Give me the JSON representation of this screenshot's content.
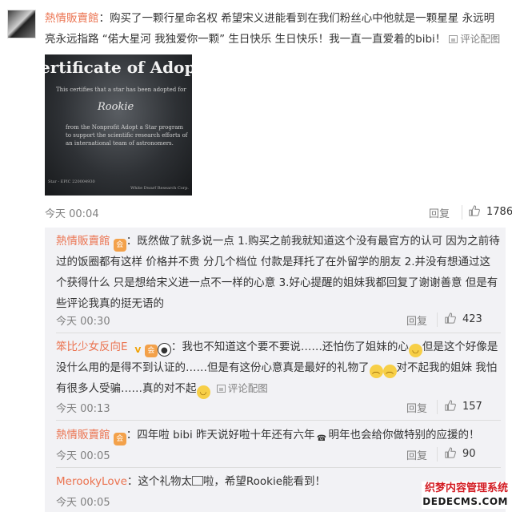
{
  "main_comment": {
    "username": "熱情販賣館",
    "text": "：购买了一颗行星命名权 希望宋义进能看到在我们粉丝心中他就是一颗星星 永远明亮永远指路 “偌大星河 我独爱你一颗” 生日快乐 生日快乐！我一直一直爱着的bibi！",
    "view_pics": "评论配图",
    "time": "今天 00:04",
    "reply": "回复",
    "likes": "1786",
    "certificate": {
      "title": "ertificate of Adopti",
      "line1": "This certifies that a star has been adopted for",
      "name": "Rookie",
      "body": "from the Nonprofit Adopt a Star program\nto support the scientific research efforts of\nan international team of astronomers.",
      "foot": "Star - EPIC 220004930",
      "foot2": "White Dwarf Research Corp."
    }
  },
  "replies": [
    {
      "username": "熱情販賣館",
      "text": "：既然做了就多说一点 1.购买之前我就知道这个没有最官方的认可 因为之前待过的饭圈都有这样 价格并不贵 分几个档位 付款是拜托了在外留学的朋友 2.并没有想通过这个获得什么 只是想给宋义进一点不一样的心意 3.好心提醒的姐妹我都回复了谢谢善意 但是有些评论我真的挺无语的",
      "time": "今天 00:30",
      "reply": "回复",
      "likes": "423"
    },
    {
      "username": "笨比少女反向E",
      "text_a": "：我也不知道这个要不要说……还怕伤了姐妹的心",
      "text_b": "但是这个好像是没什么用的是得不到认证的……但是有这份心意真是最好的礼物了",
      "text_c": "对不起我的姐妹 我怕有很多人受骗……真的对不起",
      "view_pics": "评论配图",
      "time": "今天 00:13",
      "reply": "回复",
      "likes": "157"
    },
    {
      "username": "熱情販賣館",
      "text_a": "：四年啦 bibi 昨天说好啦十年还有六年",
      "text_b": "明年也会给你做特别的应援的！",
      "time": "今天 00:05",
      "reply": "回复",
      "likes": "90"
    },
    {
      "username": "MerookyLove",
      "text_a": "：这个礼物太",
      "text_b": "啦，希望Rookie能看到！",
      "time": "今天 00:05"
    }
  ],
  "watermark": {
    "line1": "织梦内容管理系统",
    "line2": "DEDECMS.COM"
  },
  "colors": {
    "username": "#eb7350",
    "meta": "#808080",
    "sub_bg": "#f2f2f5"
  },
  "icons": [
    "thumb-up-icon",
    "picture-icon",
    "member-badge-icon",
    "crying-face-icon",
    "panda-icon",
    "v-badge-icon"
  ]
}
